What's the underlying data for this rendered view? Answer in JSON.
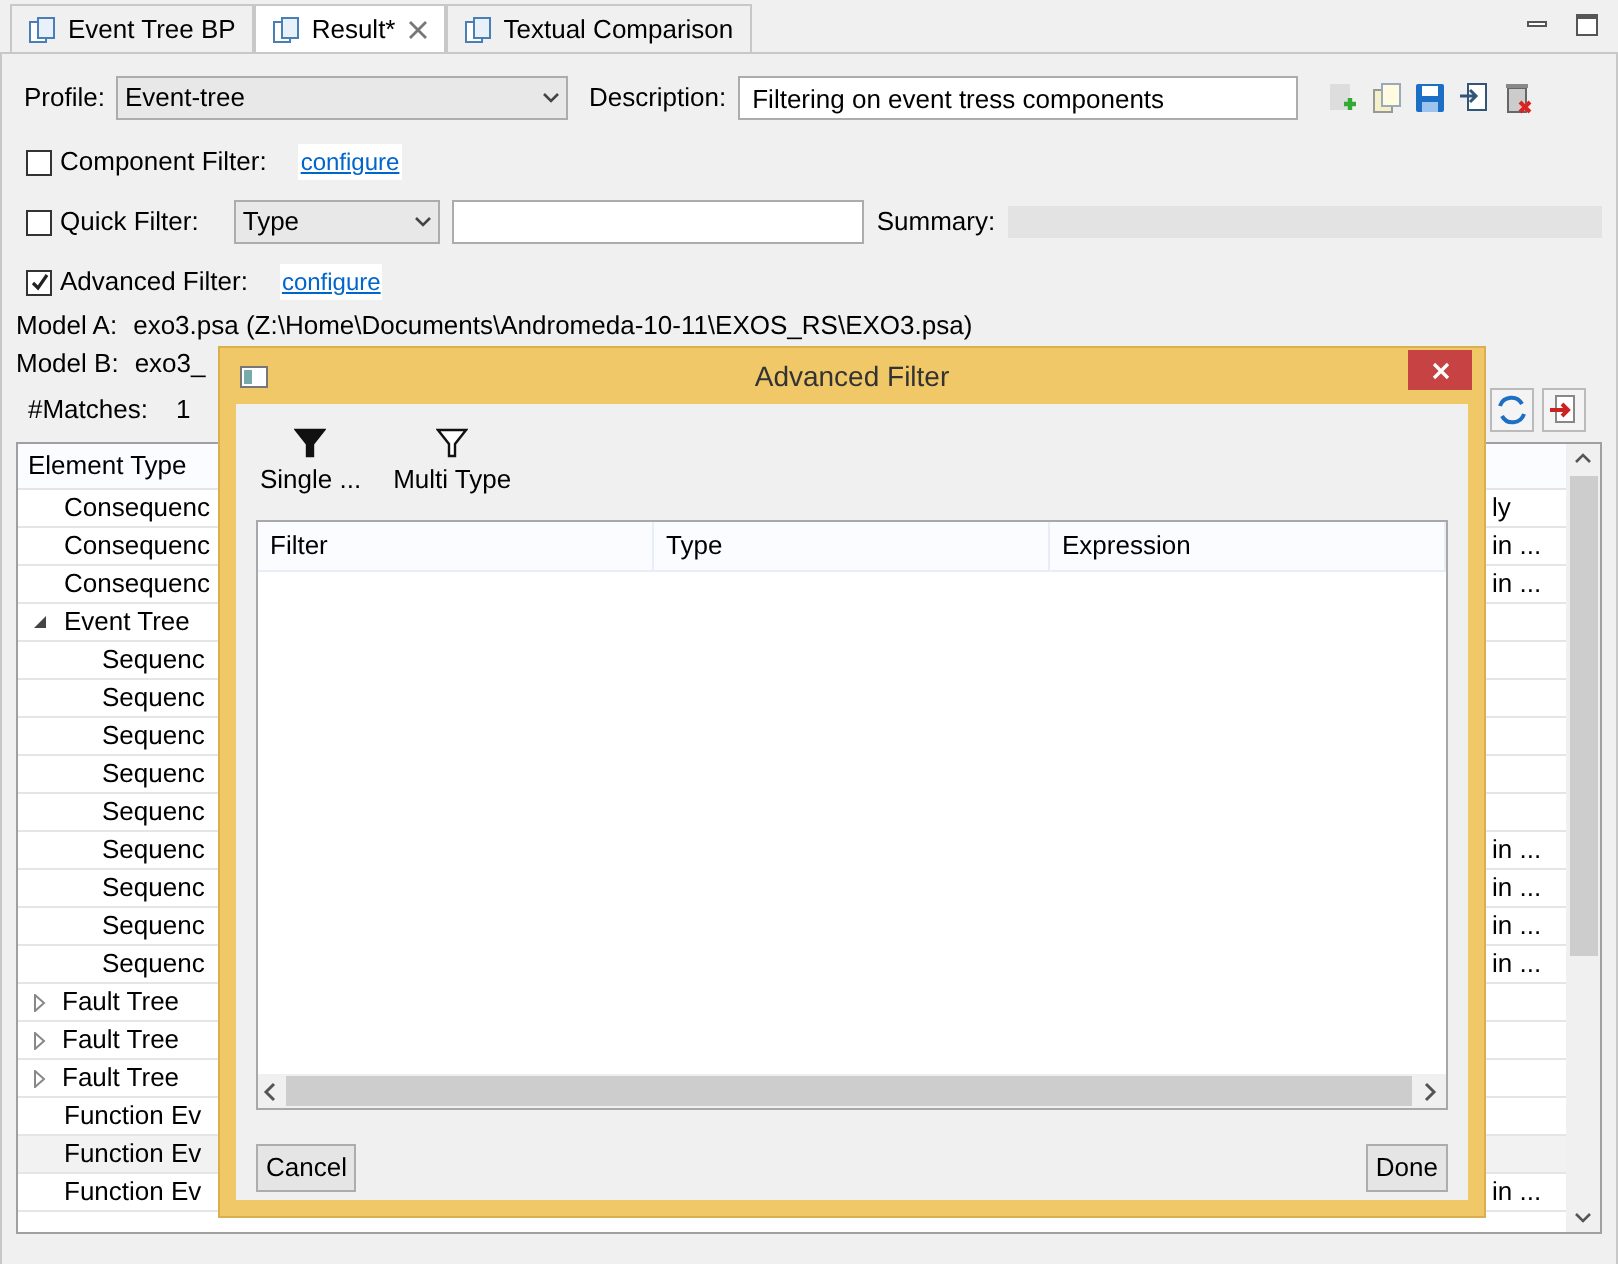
{
  "tabs": [
    {
      "label": "Event Tree BP",
      "selected": false,
      "closable": false
    },
    {
      "label": "Result*",
      "selected": true,
      "closable": true
    },
    {
      "label": "Textual Comparison",
      "selected": false,
      "closable": false
    }
  ],
  "profile": {
    "label": "Profile:",
    "value": "Event-tree"
  },
  "description": {
    "label": "Description:",
    "value": "Filtering on event tress components"
  },
  "component_filter": {
    "label": "Component Filter:",
    "checked": false,
    "link": "configure"
  },
  "quick_filter": {
    "label": "Quick Filter:",
    "checked": false,
    "type": "Type",
    "summary_label": "Summary:"
  },
  "advanced_filter": {
    "label": "Advanced Filter:",
    "checked": true,
    "link": "configure"
  },
  "model_a": {
    "label": "Model A:",
    "value": "exo3.psa (Z:\\Home\\Documents\\Andromeda-10-11\\EXOS_RS\\EXO3.psa)"
  },
  "model_b": {
    "label": "Model B:",
    "value": "exo3_"
  },
  "matches": {
    "label": "#Matches:",
    "value": "1"
  },
  "table": {
    "columns": [
      "Element Type"
    ],
    "rows": [
      {
        "name": "Consequenc",
        "last": "ly",
        "selected": false
      },
      {
        "name": "Consequenc",
        "last": "in ...",
        "selected": false
      },
      {
        "name": "Consequenc",
        "last": "in ...",
        "selected": false
      },
      {
        "name": "Event Tree",
        "expanded": true,
        "selected": false,
        "children": [
          {
            "name": "Sequenc",
            "selected": false
          },
          {
            "name": "Sequenc",
            "selected": false
          },
          {
            "name": "Sequenc",
            "selected": false
          },
          {
            "name": "Sequenc",
            "selected": false
          },
          {
            "name": "Sequenc",
            "selected": false
          },
          {
            "name": "Sequenc",
            "last": "in ...",
            "selected": false
          },
          {
            "name": "Sequenc",
            "last": "in ...",
            "selected": false
          },
          {
            "name": "Sequenc",
            "last": "in ...",
            "selected": false
          },
          {
            "name": "Sequenc",
            "last": "in ...",
            "selected": false
          }
        ]
      },
      {
        "name": "Fault Tree",
        "expanded": false,
        "selected": false
      },
      {
        "name": "Fault Tree",
        "expanded": false,
        "selected": false
      },
      {
        "name": "Fault Tree",
        "expanded": false,
        "selected": false
      },
      {
        "name": "Function Ev",
        "selected": false
      },
      {
        "name": "Function Ev",
        "selected": true
      },
      {
        "name": "Function Ev",
        "last": "in ...",
        "selected": false
      }
    ]
  },
  "dialog": {
    "title": "Advanced Filter",
    "tools": [
      {
        "label": "Single ...",
        "kind": "single"
      },
      {
        "label": "Multi Type",
        "kind": "multi"
      }
    ],
    "columns": [
      "Filter",
      "Type",
      "Expression"
    ],
    "buttons": [
      "Cancel",
      "Done"
    ]
  }
}
